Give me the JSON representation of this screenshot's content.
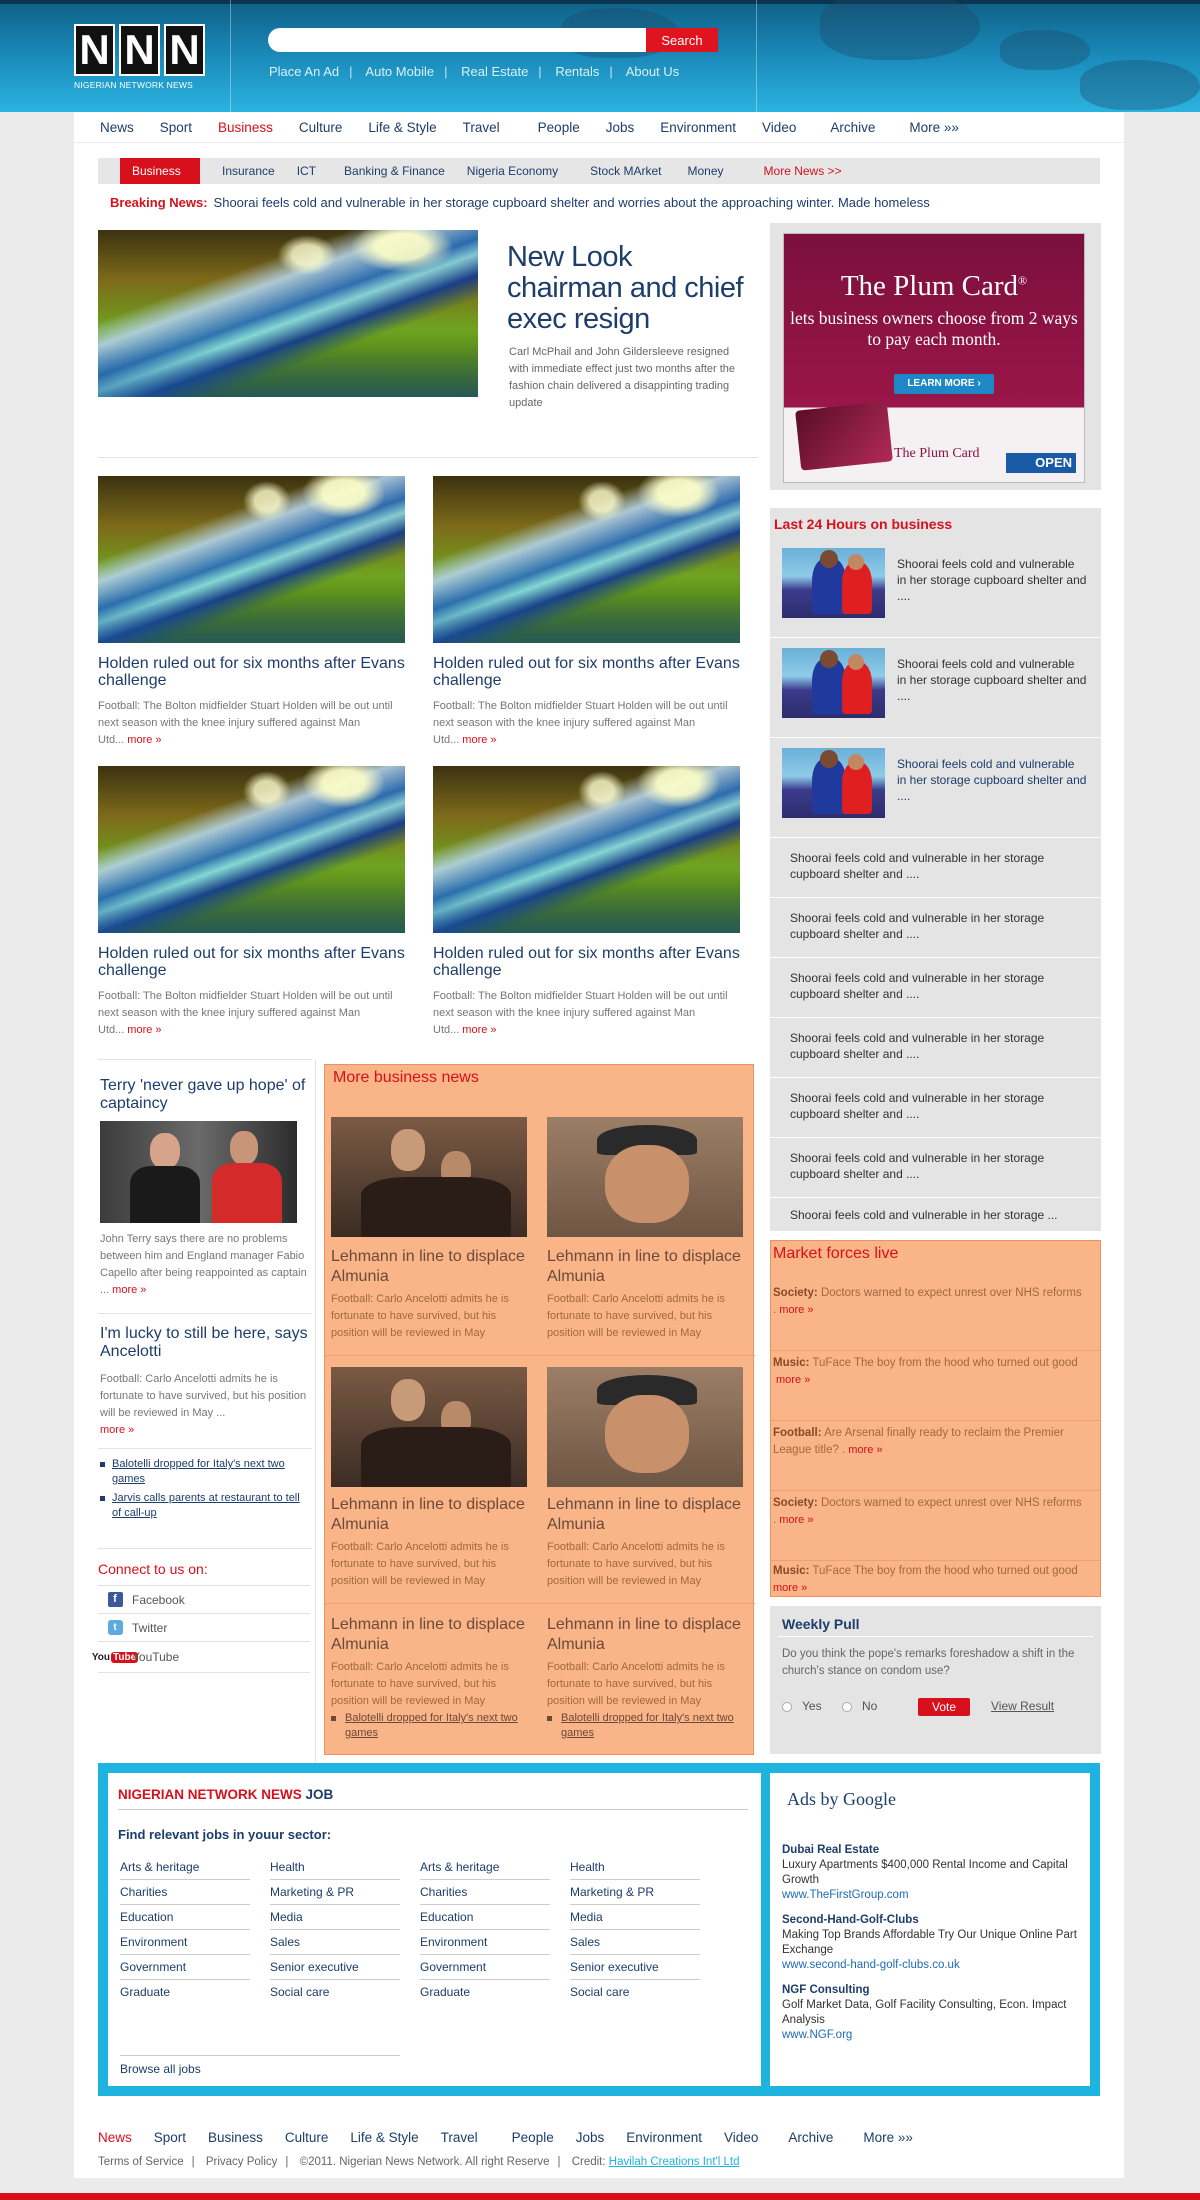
{
  "header": {
    "logo_letters": [
      "N",
      "N",
      "N"
    ],
    "logo_subtitle": "NIGERIAN NETWORK NEWS",
    "search_placeholder": "",
    "search_button": "Search",
    "top_links": [
      "Place An Ad",
      "Auto Mobile",
      "Real Estate",
      "Rentals",
      "About Us"
    ]
  },
  "nav": {
    "items": [
      "News",
      "Sport",
      "Business",
      "Culture",
      "Life & Style",
      "Travel",
      "People",
      "Jobs",
      "Environment",
      "Video",
      "Archive",
      "More »»"
    ],
    "active": "Business"
  },
  "subnav": {
    "current": "Business",
    "items": [
      "Insurance",
      "ICT",
      "Banking & Finance",
      "Nigeria Economy",
      "Stock MArket",
      "Money"
    ],
    "more": "More News >>"
  },
  "breaking": {
    "label": "Breaking News:",
    "text": "Shoorai feels cold and vulnerable in her storage cupboard shelter and worries about the approaching winter. Made homeless"
  },
  "lead": {
    "title": "New Look chairman and chief exec resign",
    "text": "Carl McPhail and John Gildersleeve resigned with immediate effect just two months after the fashion chain delivered a disappinting trading update"
  },
  "stories": [
    {
      "title": "Holden ruled out for six months after Evans challenge",
      "text": "Football: The Bolton midfielder Stuart Holden will be out until next season with the knee injury suffered against Man Utd...",
      "more": "more »"
    },
    {
      "title": "Holden ruled out for six months after Evans challenge",
      "text": "Football: The Bolton midfielder Stuart Holden will be out until next season with the knee injury suffered against Man Utd...",
      "more": "more »"
    },
    {
      "title": "Holden ruled out for six months after Evans challenge",
      "text": "Football: The Bolton midfielder Stuart Holden will be out until next season with the knee injury suffered against Man Utd...",
      "more": "more »"
    },
    {
      "title": "Holden ruled out for six months after Evans challenge",
      "text": "Football: The Bolton midfielder Stuart Holden will be out until next season with the knee injury suffered against Man Utd...",
      "more": "more »"
    }
  ],
  "left_col": {
    "story1_title": "Terry 'never gave up hope' of captaincy",
    "story1_text": "John Terry says there are no problems between him and England manager Fabio Capello after being reappointed as captain ...",
    "story1_more": "more »",
    "story2_title": "I'm lucky to still be here, says Ancelotti",
    "story2_text": "Football: Carlo Ancelotti admits he is fortunate to have survived, but his position will be reviewed in May ...",
    "story2_more": "more »",
    "bullets": [
      "Balotelli dropped for Italy's next two games",
      "Jarvis calls parents at restaurant to tell of call-up"
    ]
  },
  "connect": {
    "heading": "Connect to us on:",
    "items": [
      "Facebook",
      "Twitter",
      "YouTube"
    ],
    "youtube_logo": "You"
  },
  "more_business": {
    "heading": "More business news",
    "items": [
      {
        "title": "Lehmann in line to displace Almunia",
        "text": "Football: Carlo Ancelotti admits he is fortunate to have survived, but his position will be reviewed in May"
      },
      {
        "title": "Lehmann in line to displace Almunia",
        "text": "Football: Carlo Ancelotti admits he is fortunate to have survived, but his position will be reviewed in May"
      },
      {
        "title": "Lehmann in line to displace Almunia",
        "text": "Football: Carlo Ancelotti admits he is fortunate to have survived, but his position will be reviewed in May"
      },
      {
        "title": "Lehmann in line to displace Almunia",
        "text": "Football: Carlo Ancelotti admits he is fortunate to have survived, but his position will be reviewed in May"
      },
      {
        "title": "Lehmann in line to displace Almunia",
        "text": "Football: Carlo Ancelotti admits he is fortunate to have survived, but his position will be reviewed in May"
      },
      {
        "title": "Lehmann in line to displace Almunia",
        "text": "Football: Carlo Ancelotti admits he is fortunate to have survived, but his position will be reviewed in May"
      }
    ],
    "bullets": [
      "Balotelli dropped for Italy's next two games",
      "Balotelli dropped for Italy's next two games"
    ]
  },
  "ad": {
    "title": "The Plum Card",
    "reg": "®",
    "tagline": "lets business owners choose from 2 ways to pay each month.",
    "button": "LEARN MORE ›",
    "footer": "The Plum Card",
    "amex": "OPEN"
  },
  "last24": {
    "heading": "Last 24 Hours on business",
    "with_images": [
      "Shoorai feels cold and vulnerable in her storage cupboard shelter and ....",
      "Shoorai feels cold and vulnerable in her storage cupboard shelter and ....",
      "Shoorai feels cold and vulnerable in her storage cupboard shelter and ...."
    ],
    "text_only": [
      "Shoorai feels cold and vulnerable in her storage cupboard shelter and ....",
      "Shoorai feels cold and vulnerable in her storage cupboard shelter and ....",
      "Shoorai feels cold and vulnerable in her storage cupboard shelter and ....",
      "Shoorai feels cold and vulnerable in her storage cupboard shelter and ....",
      "Shoorai feels cold and vulnerable in her storage cupboard shelter and ....",
      "Shoorai feels cold and vulnerable in her storage cupboard shelter and ....",
      "Shoorai feels cold and vulnerable in her storage ..."
    ]
  },
  "market": {
    "heading": "Market forces live",
    "items": [
      {
        "label": "Society:",
        "text": "Doctors warned to expect unrest over NHS reforms .",
        "more": "more »"
      },
      {
        "label": "Music:",
        "text": "TuFace The boy from the hood who turned out good",
        "more": "more »"
      },
      {
        "label": "Football:",
        "text": "Are Arsenal finally ready to reclaim the Premier League title? .",
        "more": "more »"
      },
      {
        "label": "Society:",
        "text": "Doctors warned to expect unrest over NHS reforms .",
        "more": "more »"
      },
      {
        "label": "Music:",
        "text": "TuFace The boy from the hood who turned out good",
        "more": "more »"
      }
    ]
  },
  "poll": {
    "heading": "Weekly Pull",
    "question": "Do you think the pope's remarks foreshadow a shift in the church's stance on condom use?",
    "yes": "Yes",
    "no": "No",
    "vote": "Vote",
    "view": "View Result"
  },
  "jobs": {
    "heading_red": "NIGERIAN NETWORK NEWS",
    "heading_blue": "JOB",
    "subheading": "Find relevant jobs in youur sector:",
    "col1": [
      "Arts & heritage",
      "Charities",
      "Education",
      "Environment",
      "Government",
      "Graduate"
    ],
    "col2": [
      "Health",
      "Marketing & PR",
      "Media",
      "Sales",
      "Senior executive",
      "Social care"
    ],
    "col3": [
      "Arts & heritage",
      "Charities",
      "Education",
      "Environment",
      "Government",
      "Graduate"
    ],
    "col4": [
      "Health",
      "Marketing & PR",
      "Media",
      "Sales",
      "Senior executive",
      "Social care"
    ],
    "browse": "Browse all jobs"
  },
  "google_ads": {
    "heading": "Ads by Google",
    "items": [
      {
        "title": "Dubai Real Estate",
        "text": "Luxury Apartments $400,000 Rental Income and Capital Growth",
        "url": "www.TheFirstGroup.com"
      },
      {
        "title": "Second-Hand-Golf-Clubs",
        "text": "Making Top Brands Affordable Try Our Unique Online Part Exchange",
        "url": "www.second-hand-golf-clubs.co.uk"
      },
      {
        "title": "NGF Consulting",
        "text": "Golf Market Data, Golf Facility Consulting, Econ. Impact Analysis",
        "url": "www.NGF.org"
      }
    ]
  },
  "footer": {
    "nav": [
      "News",
      "Sport",
      "Business",
      "Culture",
      "Life & Style",
      "Travel",
      "People",
      "Jobs",
      "Environment",
      "Video",
      "Archive",
      "More »»"
    ],
    "terms": "Terms of Service",
    "privacy": "Privacy Policy",
    "copyright": "©2011. Nigerian News Network. All right Reserve",
    "credit_label": "Credit:",
    "credit": "Havilah Creations Int'l Ltd"
  },
  "colors": {
    "accent_red": "#d8101c",
    "header_blue": "#1a8ab9",
    "orange_panel": "#f9b487",
    "link_navy": "#1d3d6b",
    "band_cyan": "#1fb3e0"
  }
}
